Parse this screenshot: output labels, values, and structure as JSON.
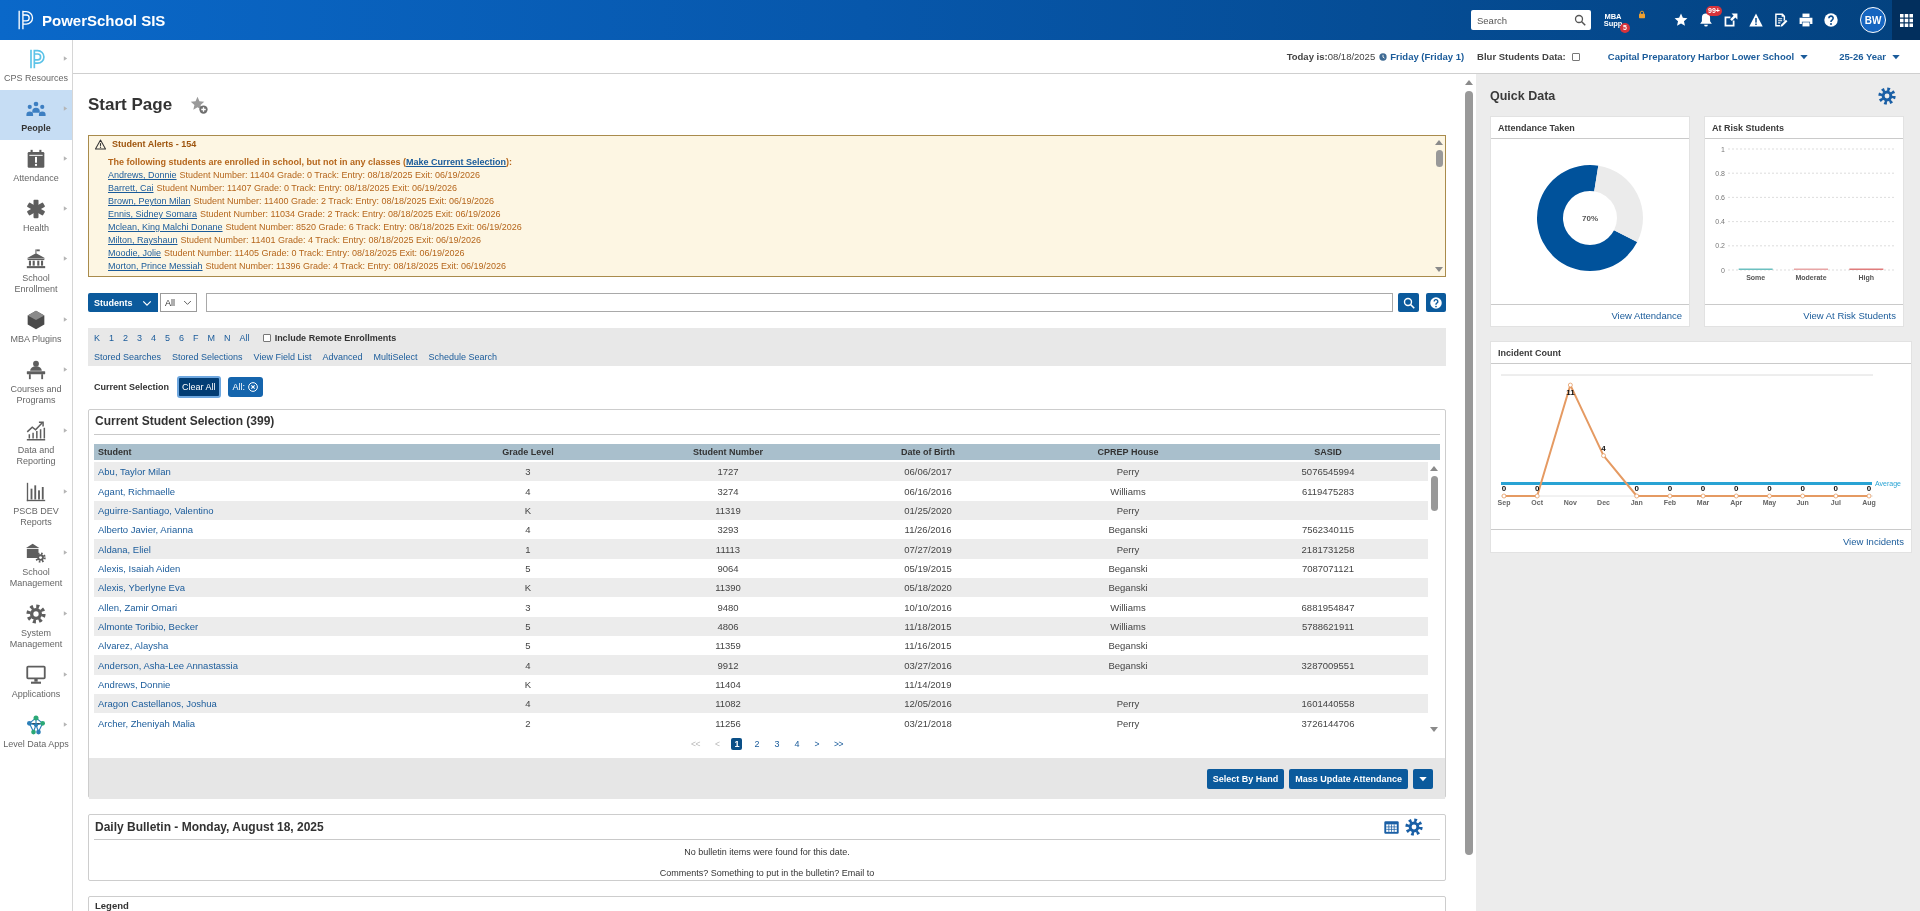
{
  "top_bar": {
    "app_name": "PowerSchool SIS",
    "search": {
      "placeholder": "Search"
    },
    "support": {
      "lines": [
        "MBA",
        "Supp"
      ],
      "badge": "5"
    },
    "notifications": {
      "badge": "99+"
    },
    "avatar": "BW"
  },
  "info_bar": {
    "today": "**Today is:**08/18/2025",
    "day": "Friday (Friday 1)",
    "blur": {
      "label": "Blur Students Data:",
      "checked": false
    },
    "school": "Capital Preparatory Harbor Lower School",
    "year": "25-26 Year"
  },
  "sidebar": {
    "items": [
      {
        "label": "CPS Resources",
        "selected": false
      },
      {
        "label": "People",
        "selected": true
      },
      {
        "label": "Attendance",
        "selected": false
      },
      {
        "label": "Health",
        "selected": false
      },
      {
        "label": "School Enrollment",
        "selected": false
      },
      {
        "label": "MBA Plugins",
        "selected": false
      },
      {
        "label": "Courses and Programs",
        "selected": false
      },
      {
        "label": "Data and Reporting",
        "selected": false
      },
      {
        "label": "PSCB DEV Reports",
        "selected": false
      },
      {
        "label": "School Management",
        "selected": false
      },
      {
        "label": "System Management",
        "selected": false
      },
      {
        "label": "Applications",
        "selected": false
      },
      {
        "label": "Level Data Apps",
        "selected": false
      }
    ]
  },
  "page": {
    "title": "Start Page"
  },
  "alerts": {
    "title": "Student Alerts - 154",
    "intro": "The following students are enrolled in school, but not in any classes (",
    "intro_link": "Make Current Selection",
    "intro_end": "):",
    "students": [
      {
        "name": "Andrews, Donnie",
        "details": "Student Number: 11404 Grade: 0 Track: Entry: 08/18/2025 Exit: 06/19/2026"
      },
      {
        "name": "Barrett, Cai",
        "details": "Student Number: 11407 Grade: 0 Track: Entry: 08/18/2025 Exit: 06/19/2026"
      },
      {
        "name": "Brown, Peyton Milan",
        "details": "Student Number: 11400 Grade: 2 Track: Entry: 08/18/2025 Exit: 06/19/2026"
      },
      {
        "name": "Ennis, Sidney Somara",
        "details": "Student Number: 11034 Grade: 2 Track: Entry: 08/18/2025 Exit: 06/19/2026"
      },
      {
        "name": "Mclean, King Malchi Donane",
        "details": "Student Number: 8520 Grade: 6 Track: Entry: 08/18/2025 Exit: 06/19/2026"
      },
      {
        "name": "Milton, Rayshaun",
        "details": "Student Number: 11401 Grade: 4 Track: Entry: 08/18/2025 Exit: 06/19/2026"
      },
      {
        "name": "Moodie, Jolie",
        "details": "Student Number: 11405 Grade: 0 Track: Entry: 08/18/2025 Exit: 06/19/2026"
      },
      {
        "name": "Morton, Prince Messiah",
        "details": "Student Number: 11396 Grade: 4 Track: Entry: 08/18/2025 Exit: 06/19/2026"
      }
    ]
  },
  "search": {
    "scope": "Students",
    "filter": "All"
  },
  "filters": {
    "grades": [
      "K",
      "1",
      "2",
      "3",
      "4",
      "5",
      "6",
      "F",
      "M",
      "N",
      "All"
    ],
    "remote": {
      "label": "Include Remote Enrollments",
      "checked": false
    },
    "links": [
      "Stored Searches",
      "Stored Selections",
      "View Field List",
      "Advanced",
      "MultiSelect",
      "Schedule Search"
    ]
  },
  "current_selection": {
    "label": "Current Selection",
    "clear": "Clear All",
    "chip": "All:"
  },
  "selection_table": {
    "title": "Current Student Selection (399)",
    "columns": [
      "Student",
      "Grade Level",
      "Student Number",
      "Date of Birth",
      "CPREP House",
      "SASID"
    ],
    "rows": [
      {
        "student": "Abu, Taylor Milan",
        "grade_level": "3",
        "student_number": "1727",
        "date_of_birth": "06/06/2017",
        "house": "Perry",
        "sasid": "5076545994"
      },
      {
        "student": "Agant, Richmaelle",
        "grade_level": "4",
        "student_number": "3274",
        "date_of_birth": "06/16/2016",
        "house": "Williams",
        "sasid": "6119475283"
      },
      {
        "student": "Aguirre-Santiago, Valentino",
        "grade_level": "K",
        "student_number": "11319",
        "date_of_birth": "01/25/2020",
        "house": "Perry"
      },
      {
        "student": "Alberto Javier, Arianna",
        "grade_level": "4",
        "student_number": "3293",
        "date_of_birth": "11/26/2016",
        "house": "Beganski",
        "sasid": "7562340115"
      },
      {
        "student": "Aldana, Eliel",
        "grade_level": "1",
        "student_number": "11113",
        "date_of_birth": "07/27/2019",
        "house": "Perry",
        "sasid": "2181731258"
      },
      {
        "student": "Alexis, Isaiah Aiden",
        "grade_level": "5",
        "student_number": "9064",
        "date_of_birth": "05/19/2015",
        "house": "Beganski",
        "sasid": "7087071121"
      },
      {
        "student": "Alexis, Yberlyne Eva",
        "grade_level": "K",
        "student_number": "11390",
        "date_of_birth": "05/18/2020",
        "house": "Beganski"
      },
      {
        "student": "Allen, Zamir Omari",
        "grade_level": "3",
        "student_number": "9480",
        "date_of_birth": "10/10/2016",
        "house": "Williams",
        "sasid": "6881954847"
      },
      {
        "student": "Almonte Toribio, Becker",
        "grade_level": "5",
        "student_number": "4806",
        "date_of_birth": "11/18/2015",
        "house": "Williams",
        "sasid": "5788621911"
      },
      {
        "student": "Alvarez, Alaysha",
        "grade_level": "5",
        "student_number": "11359",
        "date_of_birth": "11/16/2015",
        "house": "Beganski"
      },
      {
        "student": "Anderson, Asha-Lee Annastassia",
        "grade_level": "4",
        "student_number": "9912",
        "date_of_birth": "03/27/2016",
        "house": "Beganski",
        "sasid": "3287009551"
      },
      {
        "student": "Andrews, Donnie",
        "grade_level": "K",
        "student_number": "11404",
        "date_of_birth": "11/14/2019"
      },
      {
        "student": "Aragon Castellanos, Joshua",
        "grade_level": "4",
        "student_number": "11082",
        "date_of_birth": "12/05/2016",
        "house": "Perry",
        "sasid": "1601440558"
      },
      {
        "student": "Archer, Zheniyah Malia",
        "grade_level": "2",
        "student_number": "11256",
        "date_of_birth": "03/21/2018",
        "house": "Perry",
        "sasid": "3726144706"
      }
    ],
    "pager": [
      {
        "label": "<<",
        "kind": "nav",
        "disabled": true,
        "selected": false
      },
      {
        "label": "<",
        "kind": "nav",
        "disabled": true,
        "selected": false
      },
      {
        "label": "1",
        "kind": "page",
        "disabled": false,
        "selected": true
      },
      {
        "label": "2",
        "kind": "page",
        "disabled": false,
        "selected": false
      },
      {
        "label": "3",
        "kind": "page",
        "disabled": false,
        "selected": false
      },
      {
        "label": "4",
        "kind": "page",
        "disabled": false,
        "selected": false
      },
      {
        "label": ">",
        "kind": "nav",
        "disabled": false,
        "selected": false
      },
      {
        "label": ">>",
        "kind": "nav",
        "disabled": false,
        "selected": false
      }
    ],
    "buttons": [
      "Select By Hand",
      "Mass Update Attendance"
    ]
  },
  "bulletin": {
    "title": "Daily Bulletin - Monday, August 18, 2025",
    "message": "No bulletin items were found for this date.",
    "comments": "Comments? Something to put in the bulletin? Email to"
  },
  "legend": {
    "title": "Legend"
  },
  "quick_data": {
    "title": "Quick Data",
    "attendance": {
      "title": "Attendance Taken",
      "center_label": "70%",
      "link": "View Attendance",
      "chart_data": {
        "type": "donut",
        "values": [
          70,
          30
        ]
      }
    },
    "at_risk": {
      "title": "At Risk Students",
      "link": "View At Risk Students",
      "chart_data": {
        "type": "bar",
        "categories": [
          "Some",
          "Moderate",
          "High"
        ],
        "values": [
          0,
          0,
          0
        ],
        "ylim": [
          0,
          1
        ],
        "yticks": [
          0,
          0.2,
          0.4,
          0.6,
          0.8,
          1
        ],
        "grid": true
      }
    },
    "incidents": {
      "title": "Incident Count",
      "link": "View Incidents",
      "chart_data": {
        "type": "line",
        "categories": [
          "Sep",
          "Oct",
          "Nov",
          "Dec",
          "Jan",
          "Feb",
          "Mar",
          "Apr",
          "May",
          "Jun",
          "Jul",
          "Aug"
        ],
        "series": [
          {
            "color": "#e59a62",
            "marker": true,
            "values": [
              0,
              0,
              11,
              4,
              0,
              0,
              0,
              0,
              0,
              0,
              0,
              0
            ]
          }
        ],
        "data_labels": true,
        "ref_lines": [
          {
            "axis": "y",
            "value": 1.25,
            "label": "Average",
            "color": "#29a3d4"
          }
        ]
      }
    }
  }
}
